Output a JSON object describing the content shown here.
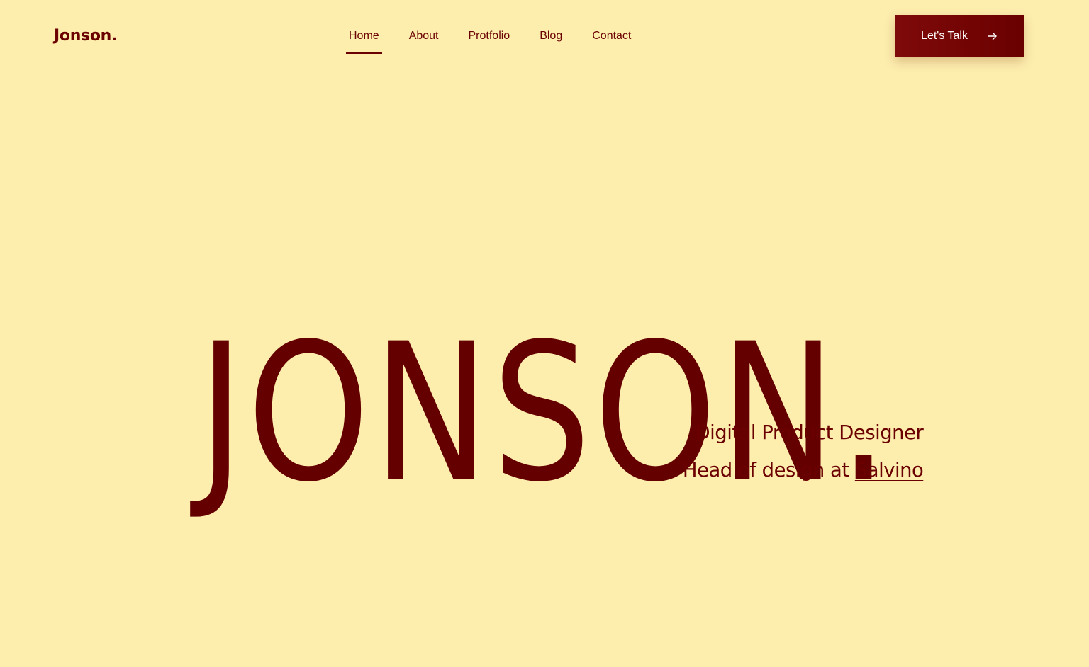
{
  "header": {
    "logo": "Jonson.",
    "nav": [
      {
        "label": "Home",
        "active": true
      },
      {
        "label": "About",
        "active": false
      },
      {
        "label": "Protfolio",
        "active": false
      },
      {
        "label": "Blog",
        "active": false
      },
      {
        "label": "Contact",
        "active": false
      }
    ],
    "cta_label": "Let's Talk",
    "cta_icon": "arrow-right-icon"
  },
  "hero": {
    "title": "JONSON.",
    "role": "Digital Product Designer",
    "position_prefix": "Head of design at",
    "company": "Salvino"
  },
  "colors": {
    "background": "#fdeeae",
    "accent": "#6b0000",
    "button_text": "#ffffff"
  }
}
